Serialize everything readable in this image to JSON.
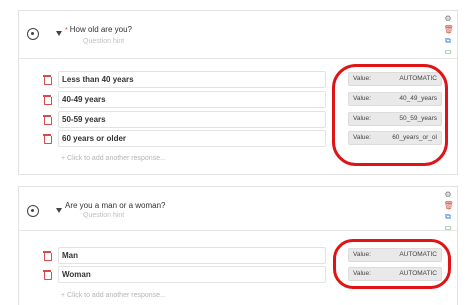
{
  "questions": [
    {
      "title": "How old are you?",
      "required_mark": "*",
      "hint": "Question hint",
      "responses": [
        {
          "label": "Less than 40 years",
          "value_label": "Value:",
          "value": "AUTOMATIC"
        },
        {
          "label": "40-49 years",
          "value_label": "Value:",
          "value": "40_49_years"
        },
        {
          "label": "50-59 years",
          "value_label": "Value:",
          "value": "50_59_years"
        },
        {
          "label": "60 years or older",
          "value_label": "Value:",
          "value": "60_years_or_ol"
        }
      ],
      "add_response": "+ Click to add another response..."
    },
    {
      "title": "Are you a man or a woman?",
      "hint": "Question hint",
      "responses": [
        {
          "label": "Man",
          "value_label": "Value:",
          "value": "AUTOMATIC"
        },
        {
          "label": "Woman",
          "value_label": "Value:",
          "value": "AUTOMATIC"
        }
      ],
      "add_response": "+ Click to add another response..."
    }
  ],
  "tools": {
    "gear": "⚙",
    "trash": "🗑",
    "copy": "⧉",
    "move": "▭"
  },
  "colors": {
    "annotation": "#e01414",
    "delete": "#d94a4a",
    "copy": "#2a7ae2",
    "move": "#2a9d4a"
  }
}
